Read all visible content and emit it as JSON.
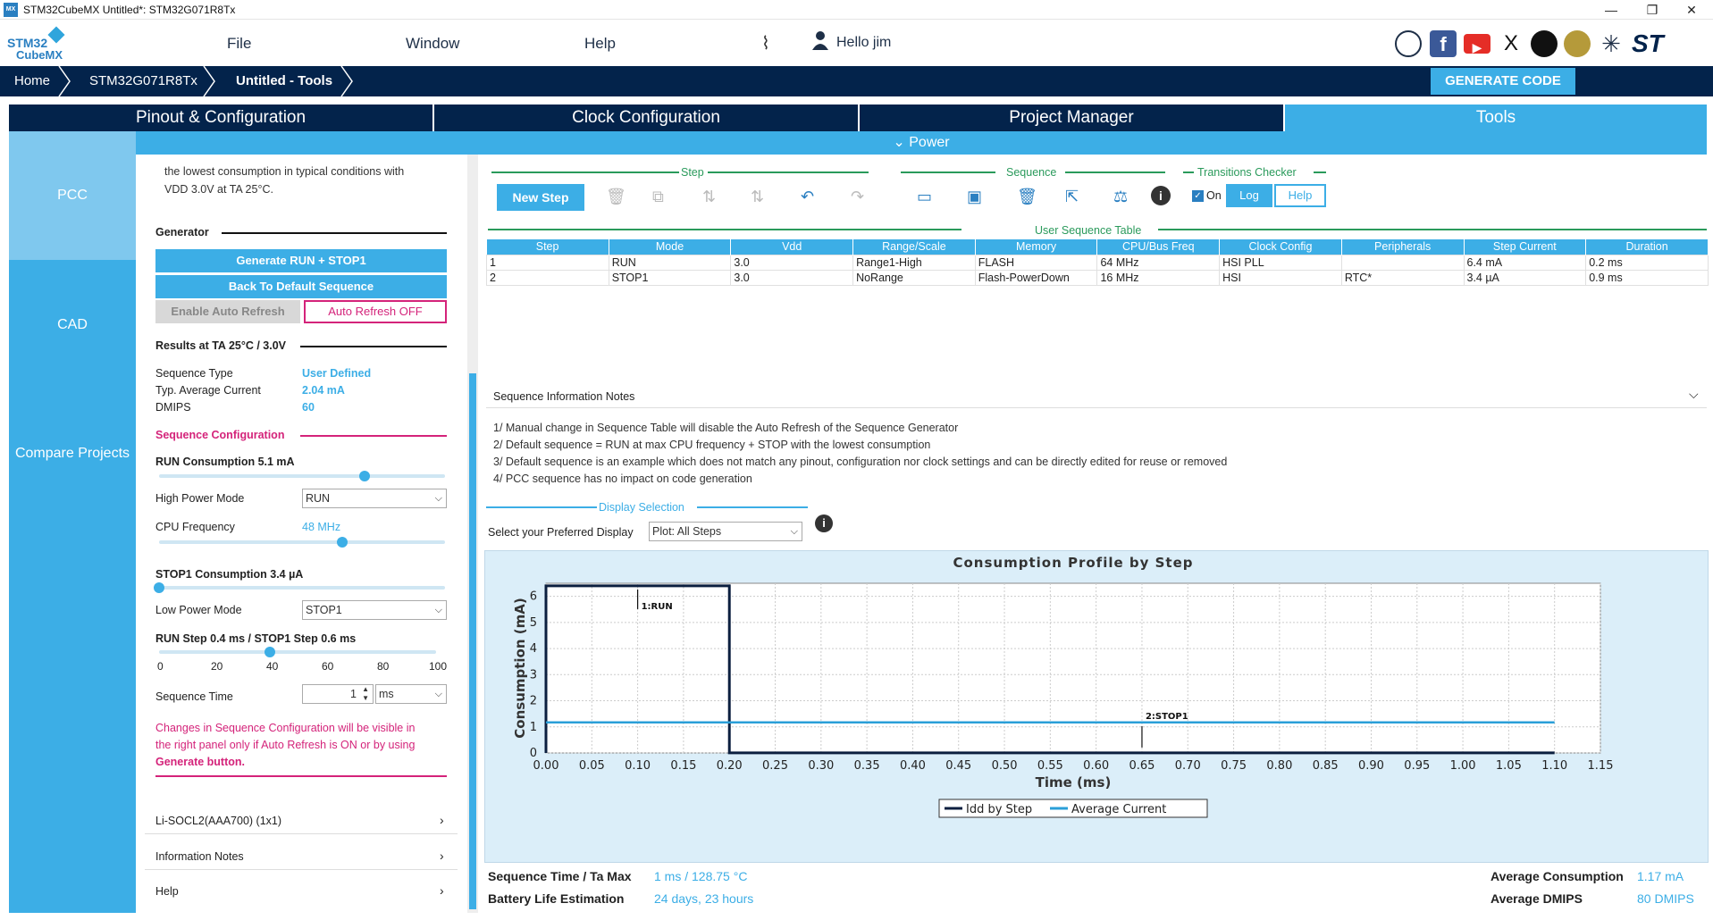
{
  "window": {
    "title": "STM32CubeMX Untitled*: STM32G071R8Tx",
    "app_icon": "MX"
  },
  "logo": {
    "line1": "STM32",
    "line2": "CubeMX"
  },
  "menu": {
    "file": "File",
    "window": "Window",
    "help": "Help",
    "user": "Hello jim"
  },
  "breadcrumb": {
    "home": "Home",
    "chip": "STM32G071R8Tx",
    "project": "Untitled - Tools"
  },
  "generate_code": "GENERATE CODE",
  "tabs": {
    "pinout": "Pinout & Configuration",
    "clock": "Clock Configuration",
    "project": "Project Manager",
    "tools": "Tools"
  },
  "power_bar": "Power",
  "leftnav": {
    "pcc": "PCC",
    "cad": "CAD",
    "compare": "Compare Projects"
  },
  "settings": {
    "intro_line1": "the lowest consumption in typical conditions with",
    "intro_line2": "VDD 3.0V at TA 25°C.",
    "generator_title": "Generator",
    "btn_generate": "Generate RUN + STOP1",
    "btn_default": "Back To Default Sequence",
    "btn_enable_refresh": "Enable Auto Refresh",
    "btn_auto_refresh": "Auto Refresh OFF",
    "results_title": "Results at TA 25°C / 3.0V",
    "seq_type_label": "Sequence Type",
    "seq_type_value": "User Defined",
    "avg_current_label": "Typ. Average Current",
    "avg_current_value": "2.04 mA",
    "dmips_label": "DMIPS",
    "dmips_value": "60",
    "seqconf_title": "Sequence Configuration",
    "run_consumption": "RUN Consumption 5.1 mA",
    "run_slider": 0.72,
    "high_power_label": "High Power Mode",
    "high_power_value": "RUN",
    "cpu_freq_label": "CPU Frequency",
    "cpu_freq_value": "48 MHz",
    "cpu_slider": 0.64,
    "stop1_consumption": "STOP1 Consumption 3.4 µA",
    "stop1_slider": 0.0,
    "low_power_label": "Low Power Mode",
    "low_power_value": "STOP1",
    "step_ratio": "RUN Step 0.4 ms / STOP1 Step 0.6 ms",
    "step_slider": 0.4,
    "ticks": [
      "0",
      "20",
      "40",
      "60",
      "80",
      "100"
    ],
    "seq_time_label": "Sequence Time",
    "seq_time_value": "1",
    "seq_time_unit": "ms",
    "note_line1": "Changes in Sequence Configuration will be visible in",
    "note_line2": "the right panel only if Auto Refresh is ON or by using",
    "note_line3": "Generate button.",
    "battery": "Li-SOCL2(AAA700) (1x1)",
    "info_notes": "Information Notes",
    "help": "Help"
  },
  "toolbar": {
    "step_group": "Step",
    "sequence_group": "Sequence",
    "transitions_group": "Transitions Checker",
    "new_step": "New Step",
    "on_label": "On",
    "log": "Log",
    "help": "Help"
  },
  "table": {
    "title": "User Sequence Table",
    "headers": [
      "Step",
      "Mode",
      "Vdd",
      "Range/Scale",
      "Memory",
      "CPU/Bus Freq",
      "Clock Config",
      "Peripherals",
      "Step Current",
      "Duration"
    ],
    "rows": [
      [
        "1",
        "RUN",
        "3.0",
        "Range1-High",
        "FLASH",
        "64 MHz",
        "HSI PLL",
        "",
        "6.4 mA",
        "0.2 ms"
      ],
      [
        "2",
        "STOP1",
        "3.0",
        "NoRange",
        "Flash-PowerDown",
        "16 MHz",
        "HSI",
        "RTC*",
        "3.4 µA",
        "0.9 ms"
      ]
    ]
  },
  "notes": {
    "title": "Sequence Information Notes",
    "n1": "1/ Manual change in Sequence Table will disable the Auto Refresh of the Sequence Generator",
    "n2": "2/ Default sequence = RUN at max CPU frequency + STOP with the lowest consumption",
    "n3": "3/ Default sequence is an example which does not match any pinout, configuration nor clock settings and can be directly edited for reuse or removed",
    "n4": "4/ PCC sequence has no impact on code generation"
  },
  "display": {
    "title": "Display Selection",
    "label": "Select your Preferred Display",
    "value": "Plot: All Steps"
  },
  "chart_data": {
    "type": "line",
    "title": "Consumption Profile by Step",
    "xlabel": "Time (ms)",
    "ylabel": "Consumption (mA)",
    "xlim": [
      0,
      1.15
    ],
    "ylim": [
      0,
      6.5
    ],
    "xticks": [
      "0.00",
      "0.05",
      "0.10",
      "0.15",
      "0.20",
      "0.25",
      "0.30",
      "0.35",
      "0.40",
      "0.45",
      "0.50",
      "0.55",
      "0.60",
      "0.65",
      "0.70",
      "0.75",
      "0.80",
      "0.85",
      "0.90",
      "0.95",
      "1.00",
      "1.05",
      "1.10",
      "1.15"
    ],
    "yticks": [
      "0",
      "1",
      "2",
      "3",
      "4",
      "5",
      "6"
    ],
    "series": [
      {
        "name": "Idd by Step",
        "color": "#0b1f3f",
        "x": [
          0,
          0,
          0.2,
          0.2,
          1.1
        ],
        "y": [
          0,
          6.4,
          6.4,
          0.0034,
          0.0034
        ]
      },
      {
        "name": "Average Current",
        "color": "#2a9fd8",
        "x": [
          0,
          1.1
        ],
        "y": [
          1.17,
          1.17
        ]
      }
    ],
    "annotations": [
      {
        "text": "1:RUN",
        "x": 0.1,
        "y": 6.4
      },
      {
        "text": "2:STOP1",
        "x": 0.65,
        "y": 0.0034
      }
    ],
    "legend": "bottom-center",
    "grid": true
  },
  "footer": {
    "seq_label": "Sequence Time / Ta Max",
    "seq_value": "1 ms / 128.75 °C",
    "battery_label": "Battery Life Estimation",
    "battery_value": "24 days, 23 hours",
    "avg_cons_label": "Average Consumption",
    "avg_cons_value": "1.17 mA",
    "avg_dmips_label": "Average DMIPS",
    "avg_dmips_value": "80 DMIPS"
  }
}
